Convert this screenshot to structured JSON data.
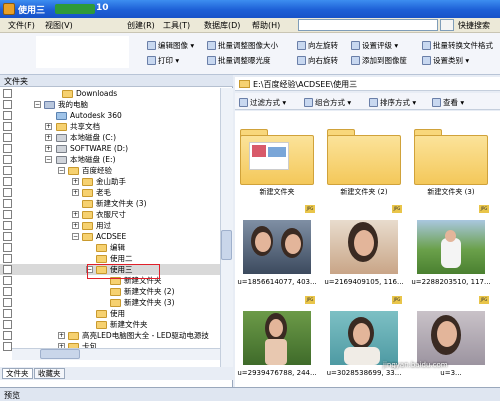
{
  "window": {
    "title": "使用三",
    "version": "10"
  },
  "menu": [
    "文件(F)",
    "视图(V)",
    "创建(R)",
    "工具(T)",
    "数据库(D)",
    "帮助(H)"
  ],
  "quick_search": "快捷搜索",
  "toolbar": {
    "items": [
      "编辑图像",
      "批量调整图像大小",
      "向左旋转",
      "设置评级",
      "批量转换文件格式",
      "打印",
      "批量调整曝光度",
      "向右旋转",
      "添加到图像筐",
      "设置类别"
    ]
  },
  "left_panel": {
    "title": "文件夹",
    "tree": [
      {
        "label": "Downloads"
      },
      {
        "label": "我的电脑"
      },
      {
        "label": "Autodesk 360"
      },
      {
        "label": "共享文档"
      },
      {
        "label": "本地磁盘 (C:)"
      },
      {
        "label": "SOFTWARE (D:)"
      },
      {
        "label": "本地磁盘 (E:)"
      },
      {
        "label": "百度经验"
      },
      {
        "label": "金山助手"
      },
      {
        "label": "老毛"
      },
      {
        "label": "新建文件夹 (3)"
      },
      {
        "label": "衣服尺寸"
      },
      {
        "label": "用过"
      },
      {
        "label": "ACDSEE"
      },
      {
        "label": "编辑"
      },
      {
        "label": "使用二"
      },
      {
        "label": "使用三",
        "selected": true
      },
      {
        "label": "新建文件夹"
      },
      {
        "label": "新建文件夹 (2)"
      },
      {
        "label": "新建文件夹 (3)"
      },
      {
        "label": "使用"
      },
      {
        "label": "新建文件夹"
      },
      {
        "label": "高亮LED电脑图大全 - LED驱动电源技"
      },
      {
        "label": "卡包"
      }
    ],
    "tabs": [
      "文件夹",
      "收藏夹"
    ]
  },
  "preview_label": "预览",
  "address": "E:\\百度经验\\ACDSEE\\使用三",
  "filter_bar": {
    "filter": "过滤方式",
    "group": "组合方式",
    "sort": "排序方式",
    "view": "查看"
  },
  "files": [
    {
      "name": "新建文件夹",
      "type": "folder"
    },
    {
      "name": "新建文件夹 (2)",
      "type": "folder"
    },
    {
      "name": "新建文件夹 (3)",
      "type": "folder"
    },
    {
      "name": "u=1856614077, 403...",
      "type": "image"
    },
    {
      "name": "u=2169409105, 116...",
      "type": "image"
    },
    {
      "name": "u=2288203510, 117...",
      "type": "image"
    },
    {
      "name": "u=2939476788, 244...",
      "type": "image"
    },
    {
      "name": "u=3028538699, 33...",
      "type": "image"
    },
    {
      "name": "u=3...",
      "type": "image"
    }
  ],
  "watermark": "jingyan.baidu.com",
  "colors": {
    "titlebar": "#1d5fd6",
    "selection_box": "#e0202a",
    "folder": "#f6d170"
  }
}
